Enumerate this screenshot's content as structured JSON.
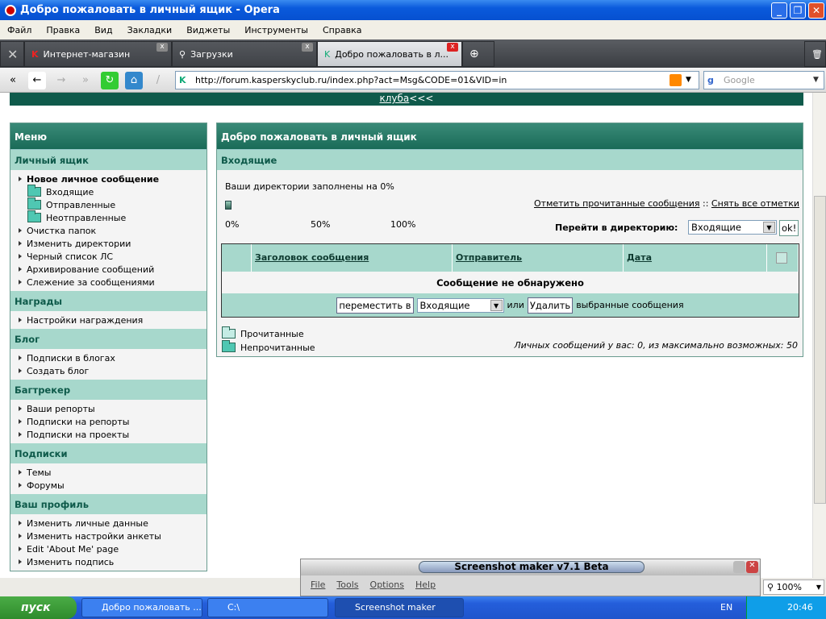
{
  "window": {
    "title": "Добро пожаловать в личный ящик - Opera",
    "min": "_",
    "max": "❐",
    "close": "✕"
  },
  "menu": [
    "Файл",
    "Правка",
    "Вид",
    "Закладки",
    "Виджеты",
    "Инструменты",
    "Справка"
  ],
  "tabs": [
    {
      "label": "Интернет-магазин"
    },
    {
      "label": "Загрузки"
    },
    {
      "label": "Добро пожаловать в л..."
    }
  ],
  "address": {
    "url": "http://forum.kasperskyclub.ru/index.php?act=Msg&CODE=01&VID=in",
    "search_placeholder": "Google"
  },
  "banner": {
    "link": "клуба",
    "suffix": "<<<"
  },
  "sidebar": {
    "title": "Меню",
    "sections": [
      {
        "title": "Личный ящик",
        "items": [
          "Новое личное сообщение",
          "Входящие",
          "Отправленные",
          "Неотправленные",
          "Очистка папок",
          "Изменить директории",
          "Черный список ЛС",
          "Архивирование сообщений",
          "Слежение за сообщениями"
        ]
      },
      {
        "title": "Награды",
        "items": [
          "Настройки награждения"
        ]
      },
      {
        "title": "Блог",
        "items": [
          "Подписки в блогах",
          "Создать блог"
        ]
      },
      {
        "title": "Багтрекер",
        "items": [
          "Ваши репорты",
          "Подписки на репорты",
          "Подписки на проекты"
        ]
      },
      {
        "title": "Подписки",
        "items": [
          "Темы",
          "Форумы"
        ]
      },
      {
        "title": "Ваш профиль",
        "items": [
          "Изменить личные данные",
          "Изменить настройки анкеты",
          "Edit 'About Me' page",
          "Изменить подпись"
        ]
      }
    ]
  },
  "main": {
    "title": "Добро пожаловать в личный ящик",
    "folder": "Входящие",
    "usage_text": "Ваши директории заполнены на 0%",
    "usage_percent": 0,
    "scale": [
      "0%",
      "50%",
      "100%"
    ],
    "mark_read": "Отметить прочитанные сообщения",
    "sep": "::",
    "unmark_all": "Снять все отметки",
    "goto_label": "Перейти в директорию:",
    "goto_value": "Входящие",
    "ok": "ok!",
    "columns": [
      "Заголовок сообщения",
      "Отправитель",
      "Дата"
    ],
    "empty": "Сообщение не обнаружено",
    "move_btn": "переместить в",
    "move_value": "Входящие",
    "or": "или",
    "delete_btn": "Удалить",
    "selected": "выбранные сообщения",
    "legend_read": "Прочитанные",
    "legend_unread": "Непрочитанные",
    "quota": "Личных сообщений у вас: 0, из максимально возможных: 50"
  },
  "screenshot_maker": {
    "title": "Screenshot maker v7.1 Beta",
    "menu": [
      "File",
      "Tools",
      "Options",
      "Help"
    ]
  },
  "status": {
    "zoom": "100%"
  },
  "taskbar": {
    "start": "пуск",
    "tasks": [
      "Добро пожаловать ...",
      "C:\\",
      "Screenshot maker"
    ],
    "lang": "EN",
    "clock": "20:46"
  }
}
